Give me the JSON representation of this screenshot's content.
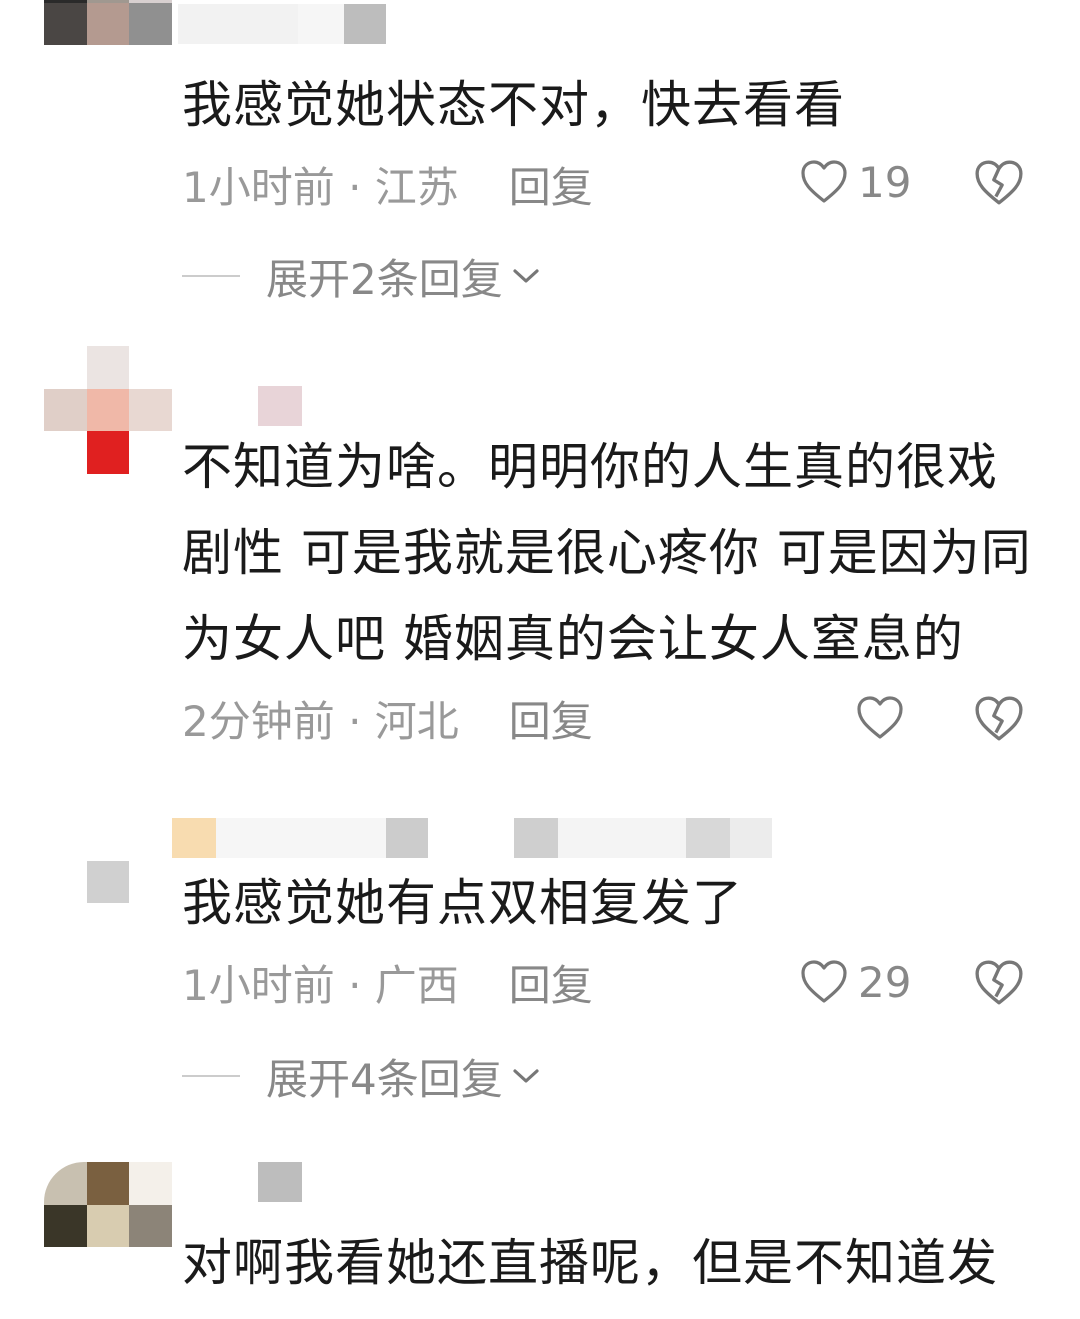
{
  "comments": [
    {
      "text": "我感觉她状态不对，快去看看",
      "time": "1小时前 · 江苏",
      "reply": "回复",
      "likes": "19",
      "expand": "展开2条回复",
      "avatar_colors": [
        "#2a2a2a",
        "#a09890",
        "#d8d0d0",
        "#4a4644",
        "#b49a90",
        "#909090",
        "#ffffff",
        "#ffffff",
        "#ffffff"
      ]
    },
    {
      "text": "不知道为啥。明明你的人生真的很戏剧性 可是我就是很心疼你 可是因为同为女人吧 婚姻真的会让女人窒息的",
      "time": "2分钟前 · 河北",
      "reply": "回复",
      "likes": "",
      "expand": "",
      "avatar_colors": [
        "#ffffff",
        "#ebe4e2",
        "#ffffff",
        "#e0cfc8",
        "#f0b8a8",
        "#e8d8d2",
        "#ffffff",
        "#e02020",
        "#ffffff"
      ]
    },
    {
      "text": "我感觉她有点双相复发了",
      "time": "1小时前 · 广西",
      "reply": "回复",
      "likes": "29",
      "expand": "展开4条回复",
      "avatar_colors": [
        "#ffffff",
        "#ffffff",
        "#ffffff",
        "#ffffff",
        "#d0d0d0",
        "#ffffff",
        "#ffffff",
        "#ffffff",
        "#ffffff"
      ]
    },
    {
      "text": "对啊我看她还直播呢，但是不知道发",
      "time": "",
      "reply": "",
      "likes": "",
      "expand": "",
      "avatar_colors": [
        "#c8c0b0",
        "#7a6040",
        "#f4f0ea",
        "#3a3628",
        "#d8ccb0",
        "#8c8478",
        "#ffffff",
        "#ffffff",
        "#ffffff"
      ]
    }
  ],
  "icons": {
    "like": "heart-outline-icon",
    "dislike": "broken-heart-icon",
    "expand": "chevron-down-icon"
  },
  "colors": {
    "text": "#1a1a1a",
    "meta": "#999999",
    "icon": "#777777"
  }
}
